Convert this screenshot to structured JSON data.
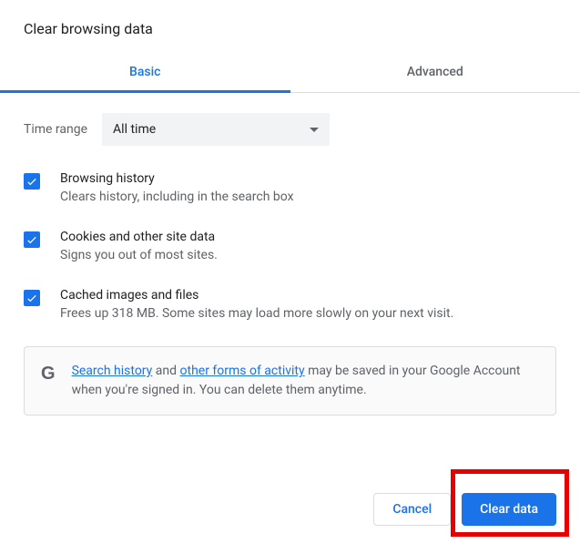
{
  "title": "Clear browsing data",
  "tabs": {
    "basic": "Basic",
    "advanced": "Advanced"
  },
  "time": {
    "label": "Time range",
    "value": "All time"
  },
  "options": [
    {
      "title": "Browsing history",
      "desc": "Clears history, including in the search box"
    },
    {
      "title": "Cookies and other site data",
      "desc": "Signs you out of most sites."
    },
    {
      "title": "Cached images and files",
      "desc": "Frees up 318 MB. Some sites may load more slowly on your next visit."
    }
  ],
  "notice": {
    "link1": "Search history",
    "mid1": " and ",
    "link2": "other forms of activity",
    "rest": " may be saved in your Google Account when you're signed in. You can delete them anytime."
  },
  "buttons": {
    "cancel": "Cancel",
    "clear": "Clear data"
  },
  "glyph": "G"
}
